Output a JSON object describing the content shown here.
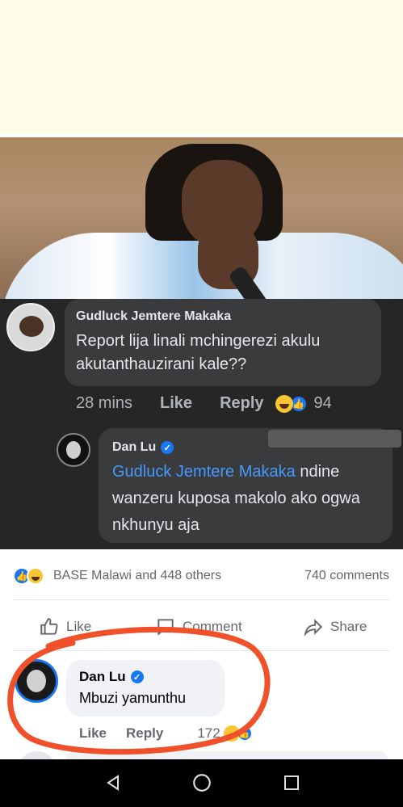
{
  "comment1": {
    "name": "Gudluck Jemtere Makaka",
    "text": "Report lija linali mchingerezi akulu akutanthauzirani kale??",
    "time": "28 mins",
    "like_label": "Like",
    "reply_label": "Reply",
    "reaction_count": "94"
  },
  "comment2": {
    "name": "Dan Lu",
    "mention": "Gudluck Jemtere Makaka",
    "text": "ndine wanzeru kuposa makolo ako ogwa nkhunyu aja"
  },
  "post": {
    "reactions_text": "BASE Malawi and 448 others",
    "comments_count": "740 comments",
    "like_label": "Like",
    "comment_label": "Comment",
    "share_label": "Share"
  },
  "comment3": {
    "name": "Dan Lu",
    "text": "Mbuzi yamunthu",
    "like_label": "Like",
    "reply_label": "Reply",
    "reaction_count": "172"
  },
  "colors": {
    "facebook_blue": "#1877f2",
    "annotation_red": "#f0502a",
    "dark_bubble": "#3a3b3c"
  },
  "icons": [
    "like-icon",
    "comment-icon",
    "share-icon",
    "verified-icon",
    "back-icon",
    "home-icon",
    "recent-apps-icon"
  ]
}
